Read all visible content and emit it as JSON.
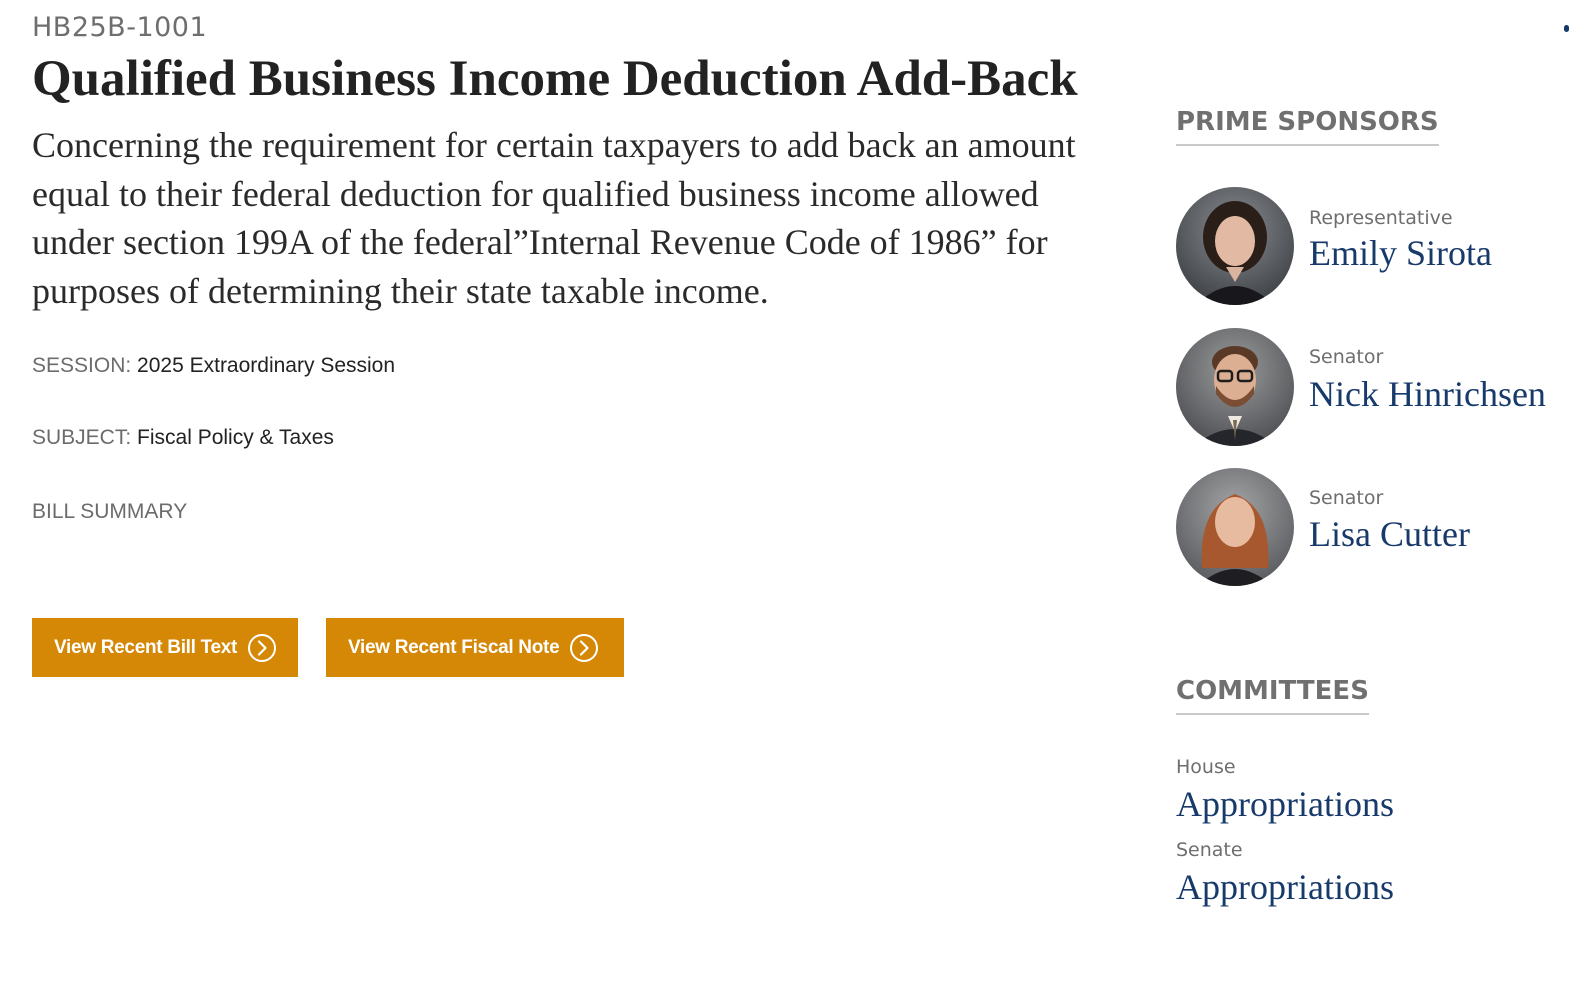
{
  "bill": {
    "number": "HB25B-1001",
    "title": "Qualified Business Income Deduction Add-Back",
    "description": "Concerning the requirement for certain taxpayers to add back an amount equal to their federal deduction for qualified business income allowed under section 199A of the federal”Internal Revenue Code of 1986” for purposes of determining their state taxable income.",
    "session_label": "SESSION:",
    "session_value": "2025 Extraordinary Session",
    "subject_label": "SUBJECT:",
    "subject_value": "Fiscal Policy & Taxes",
    "summary_label": "BILL SUMMARY"
  },
  "buttons": {
    "bill_text": "View Recent Bill Text",
    "fiscal_note": "View Recent Fiscal Note",
    "icon": "chevron-right-circle-icon",
    "color": "#d48806"
  },
  "sidebar": {
    "sponsors_heading": "PRIME SPONSORS",
    "sponsors": [
      {
        "role": "Representative",
        "name": "Emily Sirota"
      },
      {
        "role": "Senator",
        "name": "Nick Hinrichsen"
      },
      {
        "role": "Senator",
        "name": "Lisa Cutter"
      }
    ],
    "committees_heading": "COMMITTEES",
    "committees": [
      {
        "chamber": "House",
        "name": "Appropriations"
      },
      {
        "chamber": "Senate",
        "name": "Appropriations"
      }
    ],
    "link_color": "#173a6b"
  }
}
